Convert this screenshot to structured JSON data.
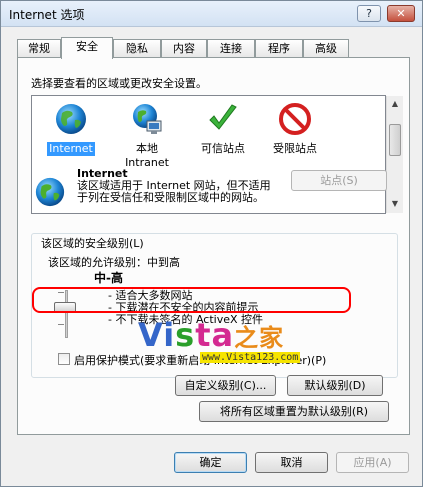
{
  "window": {
    "title": "Internet 选项",
    "help_label": "?",
    "close_label": "✕"
  },
  "tabs": [
    {
      "label": "常规"
    },
    {
      "label": "安全"
    },
    {
      "label": "隐私"
    },
    {
      "label": "内容"
    },
    {
      "label": "连接"
    },
    {
      "label": "程序"
    },
    {
      "label": "高级"
    }
  ],
  "security": {
    "zone_prompt": "选择要查看的区域或更改安全设置。",
    "zones": [
      {
        "label": "Internet",
        "icon": "globe-icon",
        "selected": true
      },
      {
        "label": "本地\nIntranet",
        "icon": "intranet-icon",
        "selected": false
      },
      {
        "label": "可信站点",
        "icon": "checkmark-icon",
        "selected": false
      },
      {
        "label": "受限站点",
        "icon": "restricted-icon",
        "selected": false
      }
    ],
    "sites_button": "站点(S)",
    "zone_name": "Internet",
    "zone_description": "该区域适用于 Internet 网站，但不适用于列在受信任和受限制区域中的网站。",
    "level_group_label": "该区域的安全级别(L)",
    "allowed_levels": "该区域的允许级别：中到高",
    "current_level": "中-高",
    "level_lines": [
      "- 适合大多数网站",
      "- 下载潜在不安全的内容前提示",
      "- 不下载未签名的 ActiveX 控件"
    ],
    "protected_mode_label": "启用保护模式(要求重新启动 Internet Explorer)(P)",
    "custom_level_button": "自定义级别(C)...",
    "default_level_button": "默认级别(D)",
    "reset_all_button": "将所有区域重置为默认级别(R)"
  },
  "footer": {
    "ok": "确定",
    "cancel": "取消",
    "apply": "应用(A)"
  },
  "watermark": {
    "brand_part1": "Vi",
    "brand_part2": "s",
    "brand_part3": "ta",
    "brand_part4": "之家",
    "url": "www.Vista123.com"
  },
  "colors": {
    "highlight_border": "#ff0000",
    "selection": "#3399ff"
  }
}
